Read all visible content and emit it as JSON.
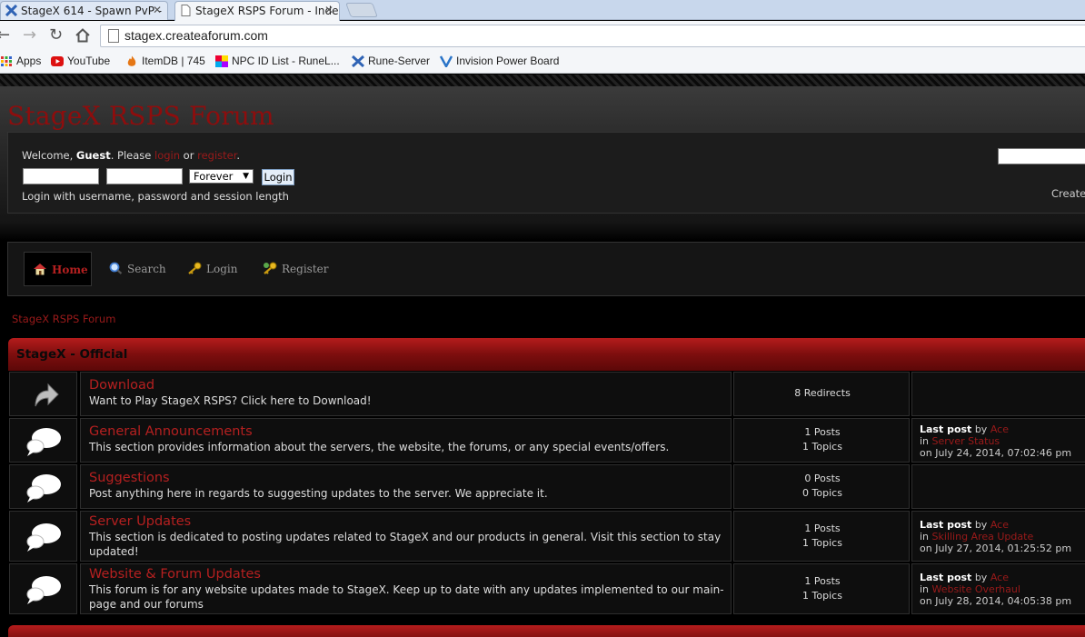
{
  "browser": {
    "tabs": [
      {
        "title": "StageX 614 - Spawn PvP -",
        "icon": "stagex-x-icon"
      },
      {
        "title": "StageX RSPS Forum - Inde",
        "icon": "page-icon"
      }
    ],
    "url": "stagex.createaforum.com",
    "bookmarks": [
      {
        "label": "Apps",
        "icon": "apps-grid-icon"
      },
      {
        "label": "YouTube",
        "icon": "youtube-icon"
      },
      {
        "label": "ItemDB | 745",
        "icon": "fire-icon"
      },
      {
        "label": "NPC ID List - RuneL...",
        "icon": "color-square-icon"
      },
      {
        "label": "Rune-Server",
        "icon": "x-icon"
      },
      {
        "label": "Invision Power Board",
        "icon": "ipb-icon"
      }
    ]
  },
  "forum": {
    "title": "StageX RSPS Forum",
    "welcome": {
      "prefix": "Welcome,",
      "guest": "Guest",
      "please": ". Please",
      "login": "login",
      "or": "or",
      "register": "register",
      "period": "."
    },
    "session_select": "Forever",
    "login_button": "Login",
    "hint": "Login with username, password and session length",
    "create_partial": "Create",
    "nav": [
      {
        "label": "Home",
        "icon": "home-icon"
      },
      {
        "label": "Search",
        "icon": "search-icon"
      },
      {
        "label": "Login",
        "icon": "key-icon"
      },
      {
        "label": "Register",
        "icon": "register-key-icon"
      }
    ],
    "breadcrumb": "StageX RSPS Forum",
    "category": "StageX - Official",
    "boards": [
      {
        "name": "Download",
        "description": "Want to Play StageX RSPS? Click here to Download!",
        "stats": [
          "8 Redirects"
        ],
        "icon": "redirect-arrow-icon",
        "last_post": null
      },
      {
        "name": "General Announcements",
        "description": "This section provides information about the servers, the website, the forums, or any special events/offers.",
        "stats": [
          "1 Posts",
          "1 Topics"
        ],
        "icon": "speech-bubble-icon",
        "last_post": {
          "label": "Last post",
          "by": "by",
          "user": "Ace",
          "in": "in",
          "topic": "Server Status",
          "date": "on July 24, 2014, 07:02:46 pm"
        }
      },
      {
        "name": "Suggestions",
        "description": "Post anything here in regards to suggesting updates to the server. We appreciate it.",
        "stats": [
          "0 Posts",
          "0 Topics"
        ],
        "icon": "speech-bubble-icon",
        "last_post": null
      },
      {
        "name": "Server Updates",
        "description": "This section is dedicated to posting updates related to StageX and our products in general. Visit this section to stay updated!",
        "stats": [
          "1 Posts",
          "1 Topics"
        ],
        "icon": "speech-bubble-icon",
        "last_post": {
          "label": "Last post",
          "by": "by",
          "user": "Ace",
          "in": "in",
          "topic": "Skilling Area Update",
          "date": "on July 27, 2014, 01:25:52 pm"
        }
      },
      {
        "name": "Website & Forum Updates",
        "description": "This forum is for any website updates made to StageX. Keep up to date with any updates implemented to our main-page and our forums",
        "stats": [
          "1 Posts",
          "1 Topics"
        ],
        "icon": "speech-bubble-icon",
        "last_post": {
          "label": "Last post",
          "by": "by",
          "user": "Ace",
          "in": "in",
          "topic": "Website Overhaul",
          "date": "on July 28, 2014, 04:05:38 pm"
        }
      }
    ]
  }
}
